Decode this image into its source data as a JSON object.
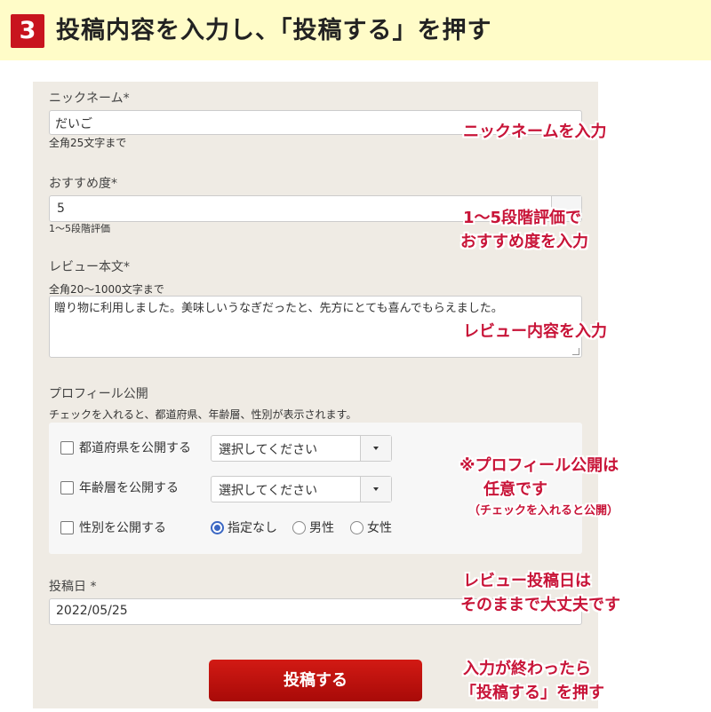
{
  "header": {
    "step_number": "3",
    "title": "投稿内容を入力し、「投稿する」を押す"
  },
  "form": {
    "nickname": {
      "label": "ニックネーム*",
      "value": "だいご",
      "hint": "全角25文字まで"
    },
    "recommendation": {
      "label": "おすすめ度*",
      "value": "5",
      "hint": "1〜5段階評価"
    },
    "review": {
      "label": "レビュー本文*",
      "hint": "全角20〜1000文字まで",
      "value": "贈り物に利用しました。美味しいうなぎだったと、先方にとても喜んでもらえました。"
    },
    "profile": {
      "label": "プロフィール公開",
      "hint": "チェックを入れると、都道府県、年齢層、性別が表示されます。",
      "prefecture": {
        "label": "都道府県を公開する",
        "checked": false,
        "select_value": "選択してください"
      },
      "age": {
        "label": "年齢層を公開する",
        "checked": false,
        "select_value": "選択してください"
      },
      "gender": {
        "label": "性別を公開する",
        "checked": false,
        "options": [
          "指定なし",
          "男性",
          "女性"
        ],
        "selected": "指定なし"
      }
    },
    "date": {
      "label": "投稿日 *",
      "value": "2022/05/25"
    },
    "submit_label": "投稿する"
  },
  "annotations": {
    "nickname": "ニックネームを入力",
    "rating_line1": "1〜5段階評価で",
    "rating_line2": "おすすめ度を入力",
    "review": "レビュー内容を入力",
    "profile_line1": "※プロフィール公開は",
    "profile_line2": "任意です",
    "profile_line3": "（チェックを入れると公開）",
    "date_line1": "レビュー投稿日は",
    "date_line2": "そのままで大丈夫です",
    "submit_line1": "入力が終わったら",
    "submit_line2": "「投稿する」を押す"
  },
  "colors": {
    "accent_red": "#c8141e",
    "annotation_red": "#c81438",
    "header_bg": "#fffcc8",
    "panel_bg": "#efebe4",
    "radio_blue": "#3b67c3"
  },
  "icons": {
    "select_arrow": "chevron-down-icon",
    "radio_selected": "radio-checked-icon"
  }
}
